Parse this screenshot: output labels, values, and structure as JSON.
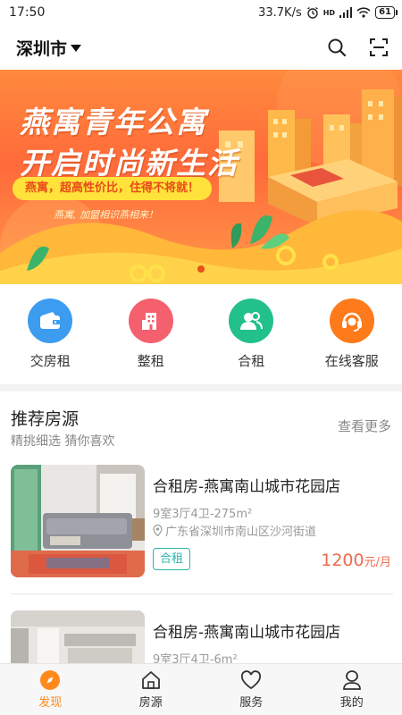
{
  "status": {
    "time": "17:50",
    "speed": "33.7K/s",
    "battery": "61",
    "hd": "HD"
  },
  "header": {
    "city": "深圳市",
    "icons": [
      "search-icon",
      "scan-icon"
    ]
  },
  "banner": {
    "title_line1": "燕寓青年公寓",
    "title_line2": "开启时尚新生活",
    "slogan": "燕寓，超高性价比，住得不将就！",
    "signature": "燕寓, 加盟相识燕相来！"
  },
  "quick_actions": [
    {
      "label": "交房租",
      "icon": "wallet-icon",
      "color": "#3b9cf0"
    },
    {
      "label": "整租",
      "icon": "building-icon",
      "color": "#f4606e"
    },
    {
      "label": "合租",
      "icon": "roommates-icon",
      "color": "#22c08a"
    },
    {
      "label": "在线客服",
      "icon": "headset-icon",
      "color": "#ff7a1a"
    }
  ],
  "recommend": {
    "title": "推荐房源",
    "subtitle": "精挑细选 猜你喜欢",
    "more": "查看更多"
  },
  "listings": [
    {
      "title": "合租房-燕寓南山城市花园店",
      "spec": "9室3厅4卫-275m²",
      "address": "广东省深圳市南山区沙河街道",
      "tag": "合租",
      "price": "1200",
      "unit": "元/月"
    },
    {
      "title": "合租房-燕寓南山城市花园店",
      "spec": "9室3厅4卫-6m²"
    }
  ],
  "bottom_nav": [
    {
      "label": "发现",
      "icon": "compass-icon",
      "active": true
    },
    {
      "label": "房源",
      "icon": "house-icon",
      "active": false
    },
    {
      "label": "服务",
      "icon": "heart-icon",
      "active": false
    },
    {
      "label": "我的",
      "icon": "user-icon",
      "active": false
    }
  ],
  "colors": {
    "accent": "#ff8a1c",
    "price": "#f06a4a",
    "tag": "#2bb5a8"
  }
}
